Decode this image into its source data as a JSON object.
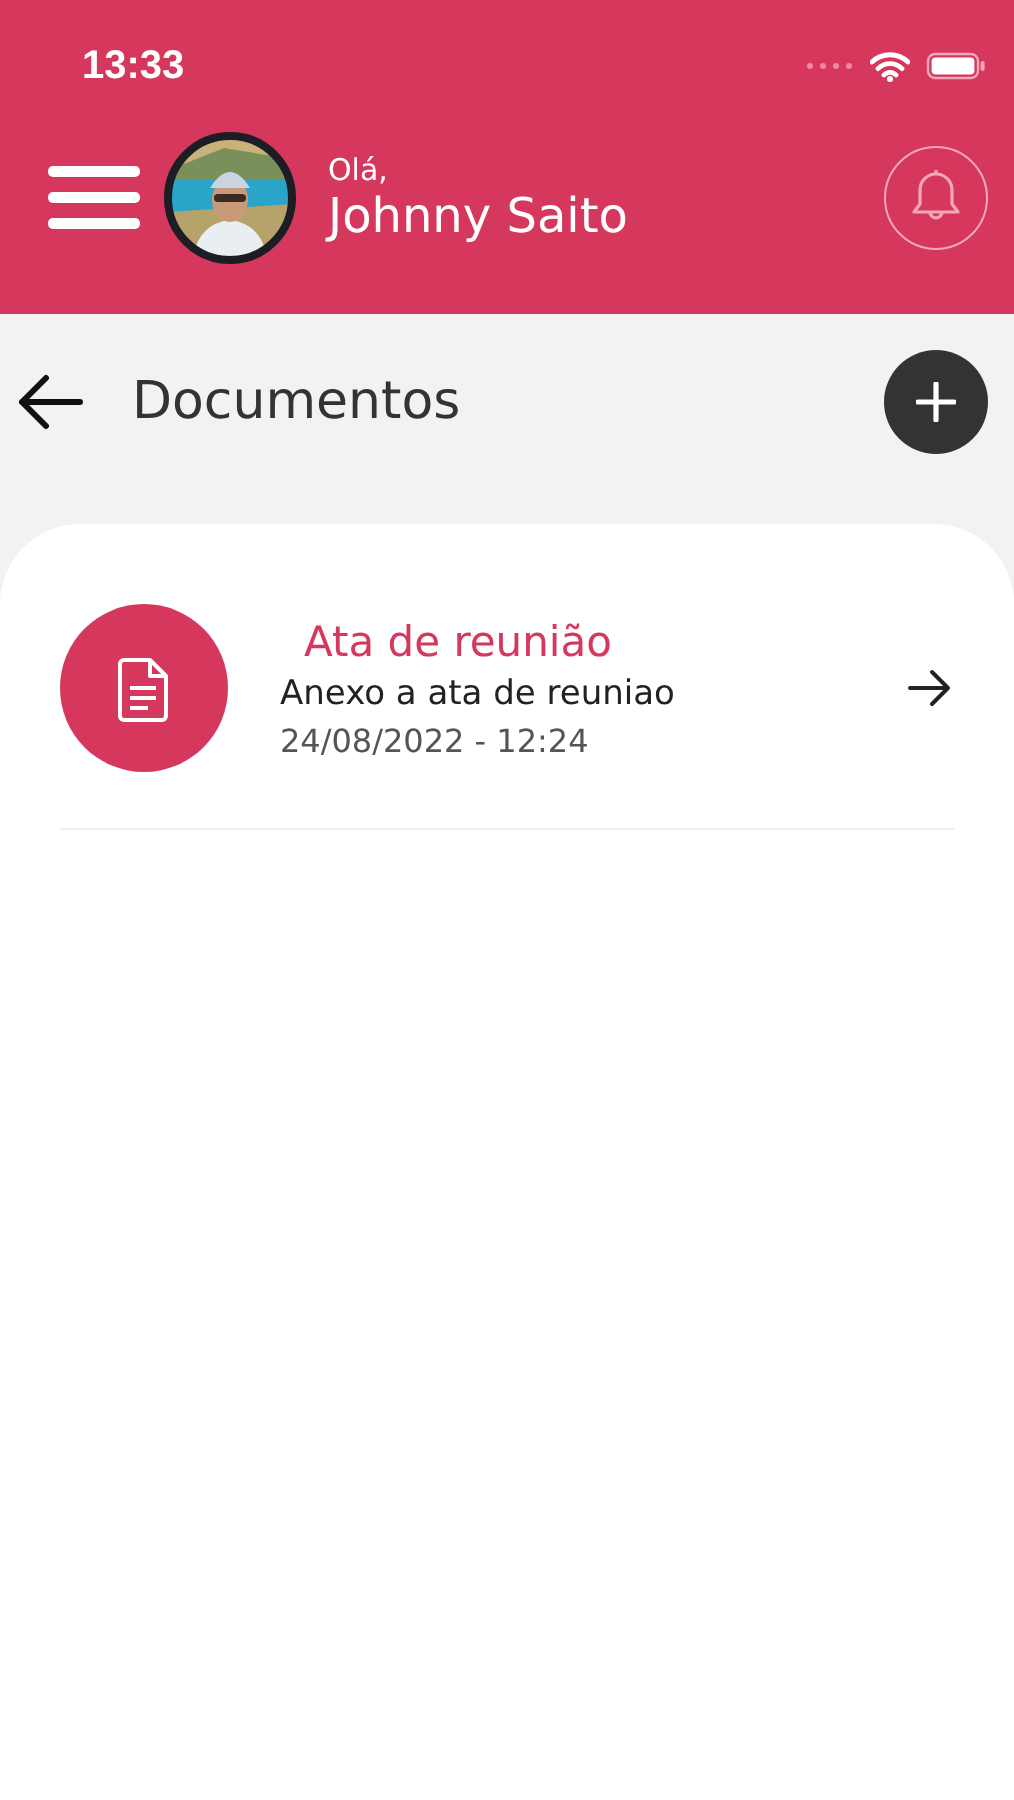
{
  "status_bar": {
    "time": "13:33"
  },
  "header": {
    "greeting": "Olá,",
    "user_name": "Johnny Saito"
  },
  "page": {
    "title": "Documentos"
  },
  "documents": [
    {
      "title": "Ata de reunião",
      "description": "Anexo a ata de reuniao",
      "date": "24/08/2022 - 12:24"
    }
  ]
}
